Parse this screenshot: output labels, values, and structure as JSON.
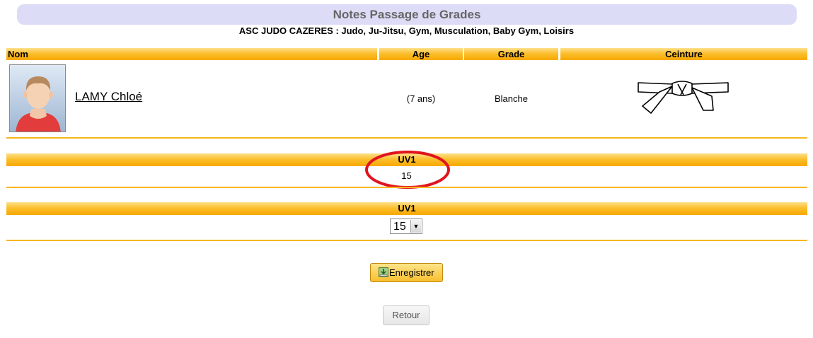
{
  "page": {
    "title": "Notes Passage de Grades",
    "club": "ASC JUDO CAZERES : Judo, Ju-Jitsu, Gym, Musculation, Baby Gym, Loisirs"
  },
  "table": {
    "columns": [
      "Nom",
      "Age",
      "Grade",
      "Ceinture"
    ],
    "row": {
      "name": "LAMY Chloé",
      "age": "(7 ans)",
      "grade": "Blanche",
      "belt_icon": "white-belt-icon"
    }
  },
  "result": {
    "header": "UV1",
    "value": "15"
  },
  "form": {
    "header": "UV1",
    "selected": "15"
  },
  "actions": {
    "save_label": "Enregistrer",
    "back_label": "Retour"
  },
  "colors": {
    "band_orange": "#f7a800",
    "title_bg": "#dcdcf7",
    "highlight_circle": "#e0141e"
  }
}
